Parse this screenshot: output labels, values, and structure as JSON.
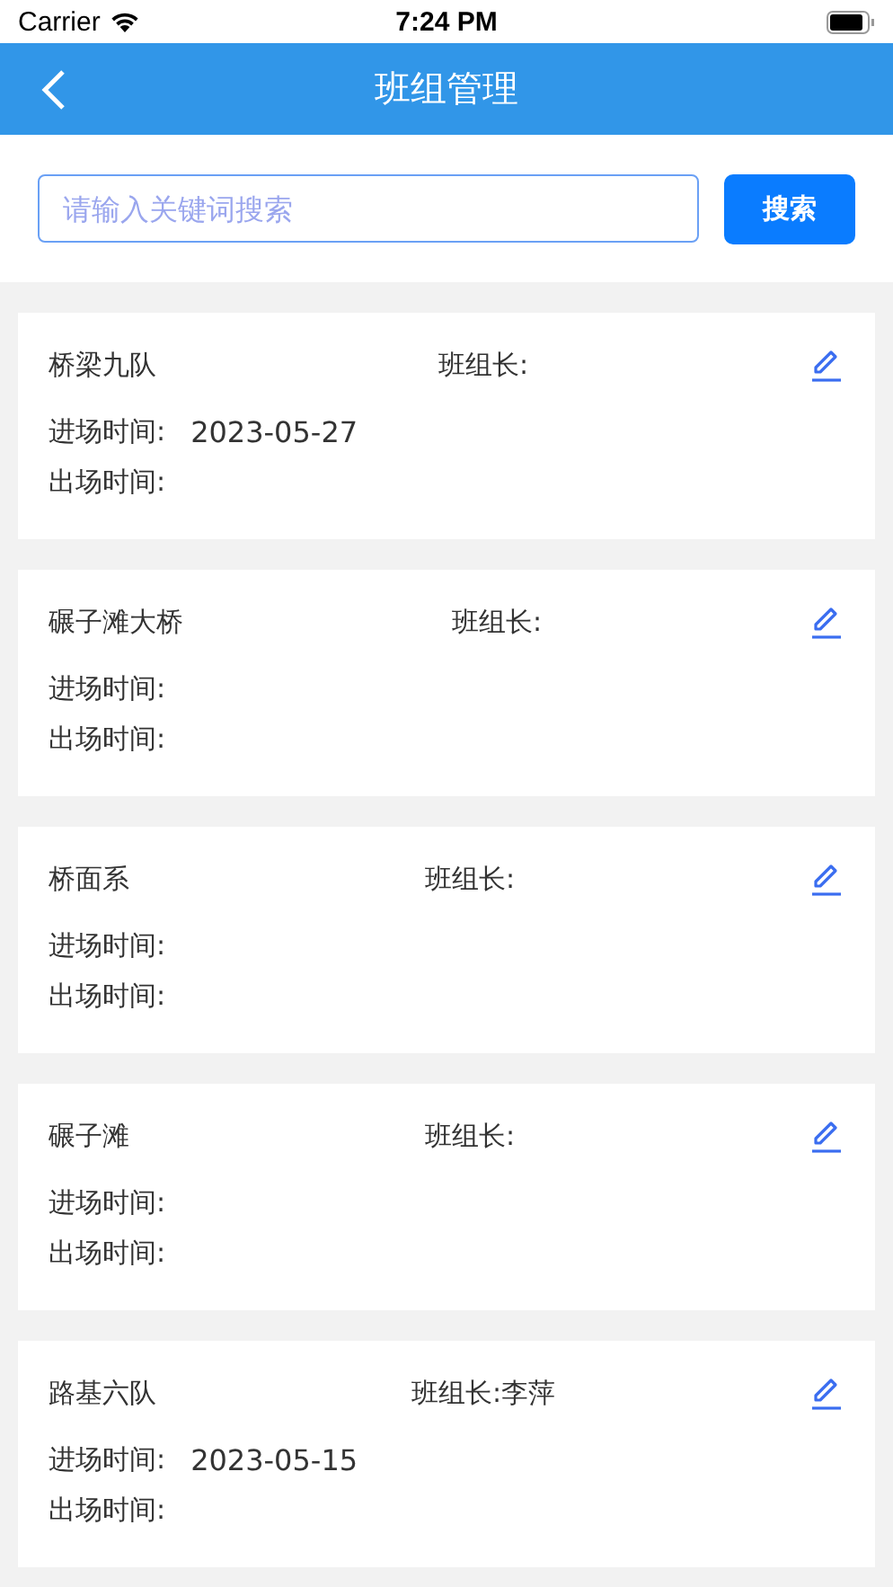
{
  "status_bar": {
    "carrier": "Carrier",
    "time": "7:24 PM"
  },
  "header": {
    "title": "班组管理"
  },
  "search": {
    "placeholder": "请输入关键词搜索",
    "button": "搜索"
  },
  "teams": [
    {
      "name": "桥梁九队",
      "leader_label": "班组长:",
      "entry_label": "进场时间:",
      "entry_date": "2023-05-27",
      "exit_label": "出场时间:"
    },
    {
      "name": "碾子滩大桥",
      "leader_label": "班组长:",
      "entry_label": "进场时间:",
      "exit_label": "出场时间:"
    },
    {
      "name": "桥面系",
      "leader_label": "班组长:",
      "entry_label": "进场时间:",
      "exit_label": "出场时间:"
    },
    {
      "name": "碾子滩",
      "leader_label": "班组长:",
      "entry_label": "进场时间:",
      "exit_label": "出场时间:"
    },
    {
      "name": "路基六队",
      "leader_label": "班组长:",
      "leader": "李萍",
      "entry_label": "进场时间:",
      "entry_date": "2023-05-15",
      "exit_label": "出场时间:"
    }
  ]
}
